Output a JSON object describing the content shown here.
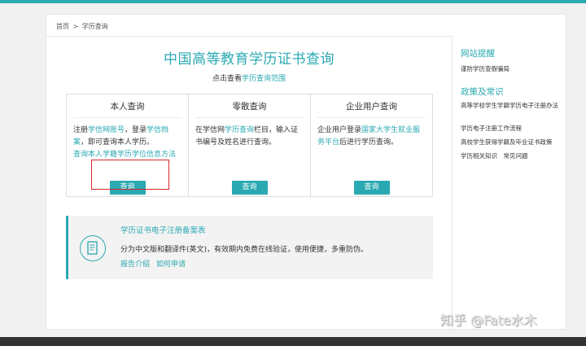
{
  "breadcrumb": {
    "home": "首页",
    "sep": ">",
    "current": "学历查询"
  },
  "main": {
    "title": "中国高等教育学历证书查询",
    "sub_prefix": "点击查看",
    "sub_link": "学历查询范围"
  },
  "boxes": [
    {
      "title": "本人查询",
      "p1": "注册",
      "l1": "学信网账号",
      "p2": "，登录",
      "l2": "学信档案",
      "p3": "，即可查询本人学历。",
      "l3": "查询本人学籍学历学位信息方法",
      "button": "查询"
    },
    {
      "title": "零散查询",
      "p1": "在学信网",
      "l1": "学历查询",
      "p2": "栏目，输入证书编号及姓名进行查询。",
      "button": "查询"
    },
    {
      "title": "企业用户查询",
      "p1": "企业用户登录",
      "l1": "国家大学生就业服务平台",
      "p2": "后进行学历查询。",
      "button": "查询"
    }
  ],
  "record": {
    "title": "学历证书电子注册备案表",
    "desc": "分为中文版和翻译件(英文)，有效期内免费在线验证，使用便捷，多重防伪。",
    "link1": "报告介绍",
    "link2": "如何申请"
  },
  "sidebar": {
    "notice_title": "网站提醒",
    "notice_items": [
      "谨防学历查假骗局"
    ],
    "policy_title": "政策及常识",
    "policy_items": [
      "高等学校学生学籍学历电子注册办法",
      "学历电子注册工作流程",
      "高校学生获得学籍及毕业证书政策",
      "学历相关知识　常见问题"
    ]
  },
  "watermark": "知乎 @Fate水木",
  "colors": {
    "accent": "#2aa9b2",
    "highlight": "#d7262a"
  }
}
